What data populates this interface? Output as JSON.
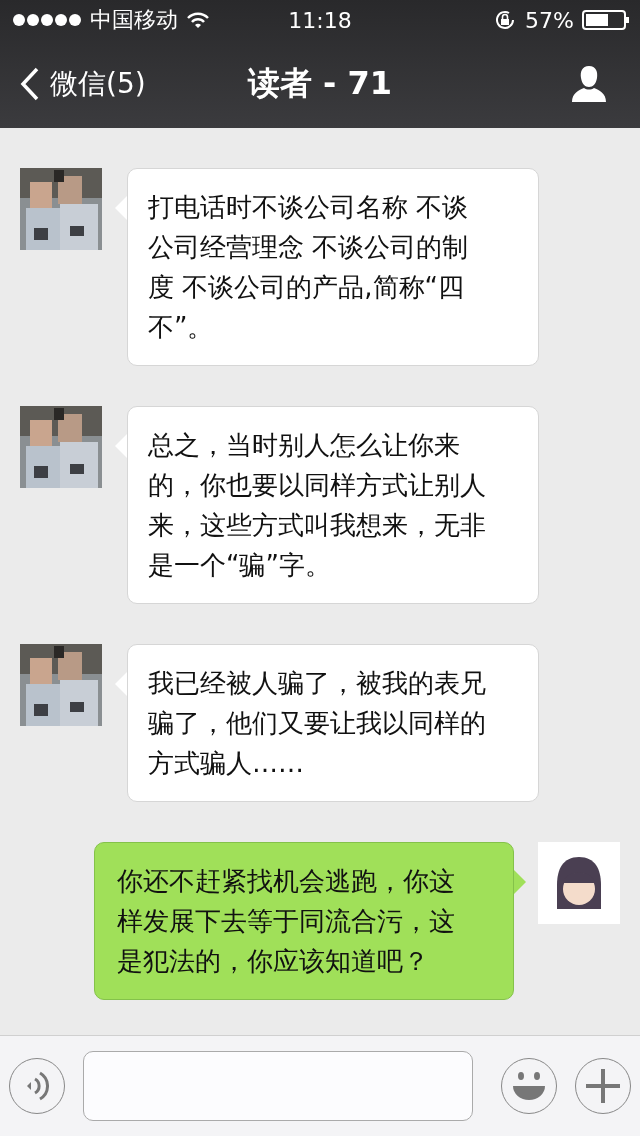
{
  "status_bar": {
    "carrier": "中国移动",
    "time": "11:18",
    "battery": "57%"
  },
  "nav": {
    "back": "微信(5)",
    "title": "读者 - 71"
  },
  "messages": [
    {
      "kind": "received",
      "text": "打电话时不谈公司名称 不谈公司经营理念 不谈公司的制度 不谈公司的产品,简称“四不”。"
    },
    {
      "kind": "received",
      "text": "总之，当时别人怎么让你来的，你也要以同样方式让别人来，这些方式叫我想来，无非是一个“骗”字。"
    },
    {
      "kind": "received",
      "text": "我已经被人骗了，被我的表兄骗了，他们又要让我以同样的方式骗人……"
    },
    {
      "kind": "sent",
      "text": "你还不赶紧找机会逃跑，你这样发展下去等于同流合污，这是犯法的，你应该知道吧？"
    }
  ]
}
